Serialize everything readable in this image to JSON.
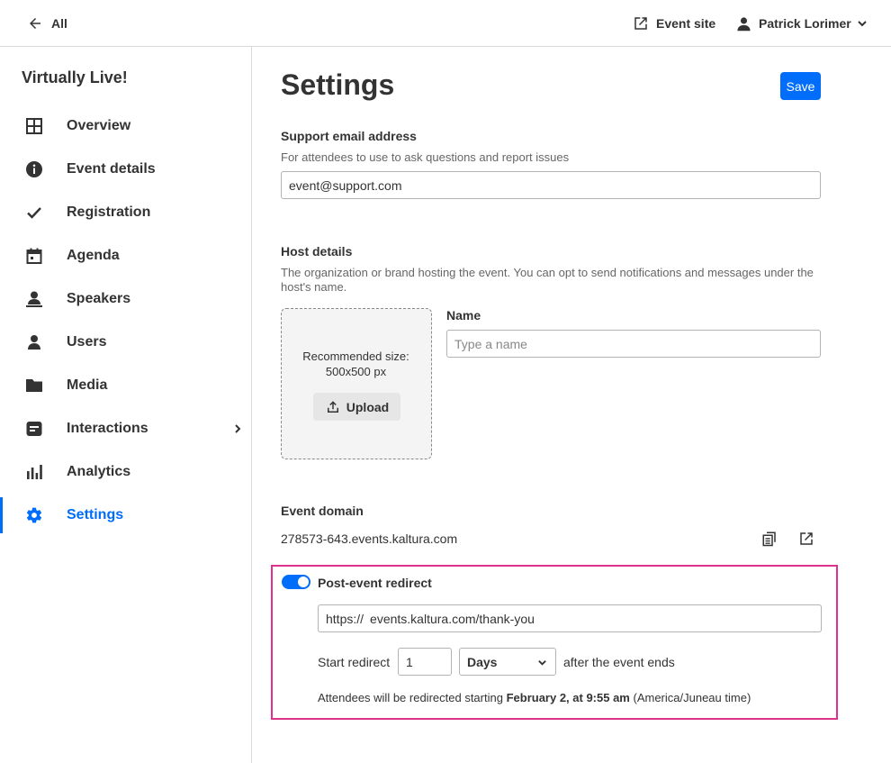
{
  "topbar": {
    "back_label": "All",
    "event_site_label": "Event site",
    "user_name": "Patrick Lorimer"
  },
  "sidebar": {
    "org_name": "Virtually Live!",
    "items": [
      {
        "label": "Overview",
        "icon": "grid-icon"
      },
      {
        "label": "Event details",
        "icon": "info-icon"
      },
      {
        "label": "Registration",
        "icon": "checkmark-icon"
      },
      {
        "label": "Agenda",
        "icon": "calendar-icon"
      },
      {
        "label": "Speakers",
        "icon": "speaker-icon"
      },
      {
        "label": "Users",
        "icon": "person-icon"
      },
      {
        "label": "Media",
        "icon": "folder-icon"
      },
      {
        "label": "Interactions",
        "icon": "chat-icon"
      },
      {
        "label": "Analytics",
        "icon": "bar-chart-icon"
      },
      {
        "label": "Settings",
        "icon": "gear-icon",
        "active": true
      }
    ]
  },
  "main": {
    "title": "Settings",
    "save_label": "Save",
    "support": {
      "title": "Support email address",
      "description": "For attendees to use to ask questions and report issues",
      "value": "event@support.com"
    },
    "host": {
      "title": "Host details",
      "description": "The organization or brand hosting the event. You can opt to send notifications and messages under the host's name.",
      "recommended_line1": "Recommended size:",
      "recommended_line2": "500x500 px",
      "upload_label": "Upload",
      "name_label": "Name",
      "name_placeholder": "Type a name"
    },
    "domain": {
      "title": "Event domain",
      "value": "278573-643.events.kaltura.com"
    },
    "redirect": {
      "enabled": true,
      "title": "Post-event redirect",
      "url_prefix": "https://",
      "url_value": "events.kaltura.com/thank-you",
      "start_label": "Start redirect",
      "delay_value": "1",
      "unit": "Days",
      "after_label": "after the event ends",
      "note_prefix": "Attendees will be redirected starting",
      "note_date": "February 2, at 9:55 am",
      "note_suffix": "(America/Juneau time)"
    }
  },
  "colors": {
    "accent": "#006efa",
    "highlight_border": "#e0318c",
    "text": "#333333"
  }
}
